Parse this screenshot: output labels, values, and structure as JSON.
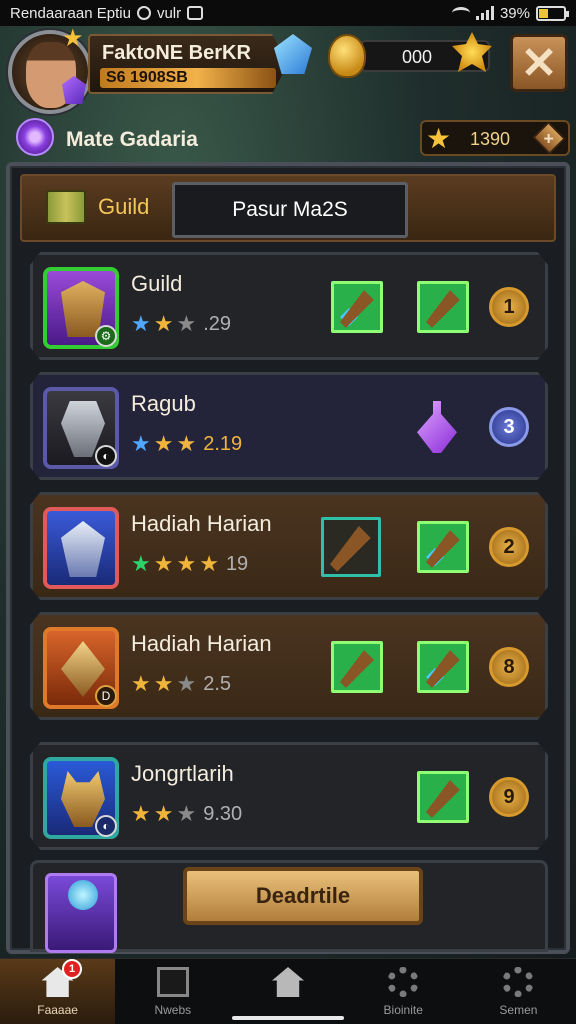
{
  "status_bar": {
    "left_text": "Rendaaraan Eptiu",
    "carrier": "vulr",
    "battery": "39%",
    "battery_level": 0.39
  },
  "player": {
    "name": "FaktoNE BerKR",
    "xp_text": "S6 1908SB",
    "guild_name": "Mate Gadaria"
  },
  "currencies": {
    "gold": "000",
    "stars": "1390",
    "add_symbol": "+"
  },
  "tabs": {
    "guild_label": "Guild",
    "active_label": "Pasur Ma2S"
  },
  "rows": [
    {
      "title": "Guild",
      "stars": [
        "blue",
        "gold",
        "grey"
      ],
      "score": ".29",
      "rank": "1",
      "color": "#33cc33"
    },
    {
      "title": "Ragub",
      "stars": [
        "blue",
        "gold",
        "gold"
      ],
      "score": "2.19",
      "rank": "3",
      "color": "#5a5aa8"
    },
    {
      "title": "Hadiah Harian",
      "stars": [
        "green",
        "gold",
        "gold",
        "gold"
      ],
      "score": "19",
      "rank": "2",
      "color": "#e05a5a"
    },
    {
      "title": "Hadiah Harian",
      "stars": [
        "gold",
        "gold",
        "grey"
      ],
      "score": "2.5",
      "rank": "8",
      "color": "#e07a2a"
    },
    {
      "title": "Jongrtlarih",
      "stars": [
        "gold",
        "gold",
        "grey"
      ],
      "score": "9.30",
      "rank": "9",
      "color": "#2fa8a0"
    }
  ],
  "action_button": "Deadrtile",
  "nav": {
    "items": [
      {
        "label": "Faaaae",
        "badge": "1"
      },
      {
        "label": "Nwebs"
      },
      {
        "label": ""
      },
      {
        "label": "Bioinite"
      },
      {
        "label": "Semen"
      }
    ]
  }
}
